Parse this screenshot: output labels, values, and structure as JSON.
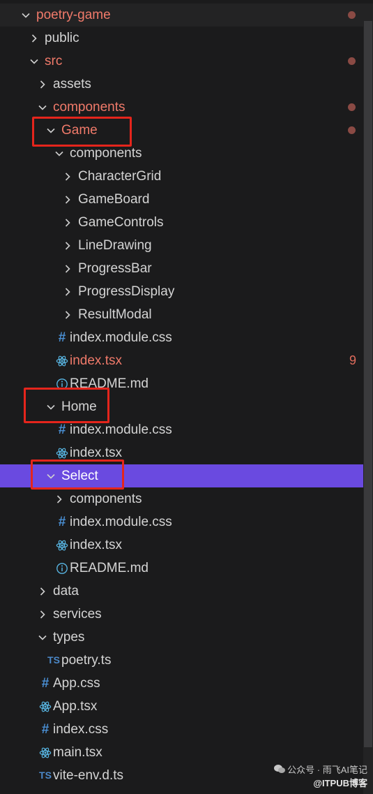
{
  "explorer": {
    "rows": [
      {
        "label": "poetry-game",
        "depth": 0,
        "type": "folder",
        "expanded": true,
        "modified": true,
        "dot": true,
        "root": true
      },
      {
        "label": "public",
        "depth": 1,
        "type": "folder",
        "expanded": false
      },
      {
        "label": "src",
        "depth": 1,
        "type": "folder",
        "expanded": true,
        "modified": true,
        "dot": true
      },
      {
        "label": "assets",
        "depth": 2,
        "type": "folder",
        "expanded": false
      },
      {
        "label": "components",
        "depth": 2,
        "type": "folder",
        "expanded": true,
        "modified": true,
        "dot": true
      },
      {
        "label": "Game",
        "depth": 3,
        "type": "folder",
        "expanded": true,
        "modified": true,
        "dot": true
      },
      {
        "label": "components",
        "depth": 4,
        "type": "folder",
        "expanded": true
      },
      {
        "label": "CharacterGrid",
        "depth": 5,
        "type": "folder",
        "expanded": false
      },
      {
        "label": "GameBoard",
        "depth": 5,
        "type": "folder",
        "expanded": false
      },
      {
        "label": "GameControls",
        "depth": 5,
        "type": "folder",
        "expanded": false
      },
      {
        "label": "LineDrawing",
        "depth": 5,
        "type": "folder",
        "expanded": false
      },
      {
        "label": "ProgressBar",
        "depth": 5,
        "type": "folder",
        "expanded": false
      },
      {
        "label": "ProgressDisplay",
        "depth": 5,
        "type": "folder",
        "expanded": false
      },
      {
        "label": "ResultModal",
        "depth": 5,
        "type": "folder",
        "expanded": false
      },
      {
        "label": "index.module.css",
        "depth": 4,
        "type": "css"
      },
      {
        "label": "index.tsx",
        "depth": 4,
        "type": "react",
        "modified": true,
        "count": "9"
      },
      {
        "label": "README.md",
        "depth": 4,
        "type": "info"
      },
      {
        "label": "Home",
        "depth": 3,
        "type": "folder",
        "expanded": true
      },
      {
        "label": "index.module.css",
        "depth": 4,
        "type": "css"
      },
      {
        "label": "index.tsx",
        "depth": 4,
        "type": "react"
      },
      {
        "label": "Select",
        "depth": 3,
        "type": "folder",
        "expanded": true,
        "selected": true
      },
      {
        "label": "components",
        "depth": 4,
        "type": "folder",
        "expanded": false
      },
      {
        "label": "index.module.css",
        "depth": 4,
        "type": "css"
      },
      {
        "label": "index.tsx",
        "depth": 4,
        "type": "react"
      },
      {
        "label": "README.md",
        "depth": 4,
        "type": "info"
      },
      {
        "label": "data",
        "depth": 2,
        "type": "folder",
        "expanded": false
      },
      {
        "label": "services",
        "depth": 2,
        "type": "folder",
        "expanded": false
      },
      {
        "label": "types",
        "depth": 2,
        "type": "folder",
        "expanded": true
      },
      {
        "label": "poetry.ts",
        "depth": 3,
        "type": "ts"
      },
      {
        "label": "App.css",
        "depth": 2,
        "type": "css"
      },
      {
        "label": "App.tsx",
        "depth": 2,
        "type": "react"
      },
      {
        "label": "index.css",
        "depth": 2,
        "type": "css"
      },
      {
        "label": "main.tsx",
        "depth": 2,
        "type": "react"
      },
      {
        "label": "vite-env.d.ts",
        "depth": 2,
        "type": "ts"
      }
    ]
  },
  "watermark": {
    "line1": "公众号 · 雨飞AI笔记",
    "line2": "@ITPUB博客"
  },
  "colors": {
    "background": "#1b1b1c",
    "selected": "#6a4ae0",
    "modified": "#f07a6a",
    "highlight": "#e5251c",
    "css_icon": "#4a8fd4",
    "react_icon": "#59b8e6",
    "ts_icon": "#4b88c8",
    "info_icon": "#59b8e6"
  }
}
